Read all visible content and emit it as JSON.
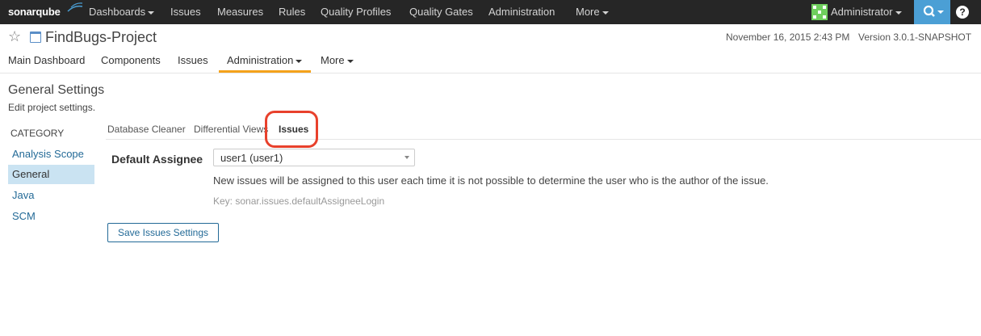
{
  "topnav": {
    "logo": "sonarqube",
    "items": [
      "Dashboards",
      "Issues",
      "Measures",
      "Rules",
      "Quality Profiles",
      "Quality Gates",
      "Administration",
      "More"
    ],
    "user": "Administrator",
    "help": "?"
  },
  "project": {
    "title": "FindBugs-Project",
    "date": "November 16, 2015 2:43 PM",
    "version": "Version 3.0.1-SNAPSHOT",
    "tabs": [
      "Main Dashboard",
      "Components",
      "Issues",
      "Administration",
      "More"
    ]
  },
  "page": {
    "title": "General Settings",
    "subtitle": "Edit project settings."
  },
  "categories": {
    "heading": "CATEGORY",
    "items": [
      "Analysis Scope",
      "General",
      "Java",
      "SCM"
    ]
  },
  "settings_tabs": [
    "Database Cleaner",
    "Differential Views",
    "Issues"
  ],
  "setting": {
    "label": "Default Assignee",
    "value": "user1 (user1)",
    "description": "New issues will be assigned to this user each time it is not possible to determine the user who is the author of the issue.",
    "key": "Key: sonar.issues.defaultAssigneeLogin"
  },
  "save_label": "Save Issues Settings",
  "colors": {
    "topbar": "#262626",
    "accent": "#4b9fd5",
    "active_tab": "#f4a21b",
    "link": "#236a97",
    "highlight": "#e8412c"
  }
}
